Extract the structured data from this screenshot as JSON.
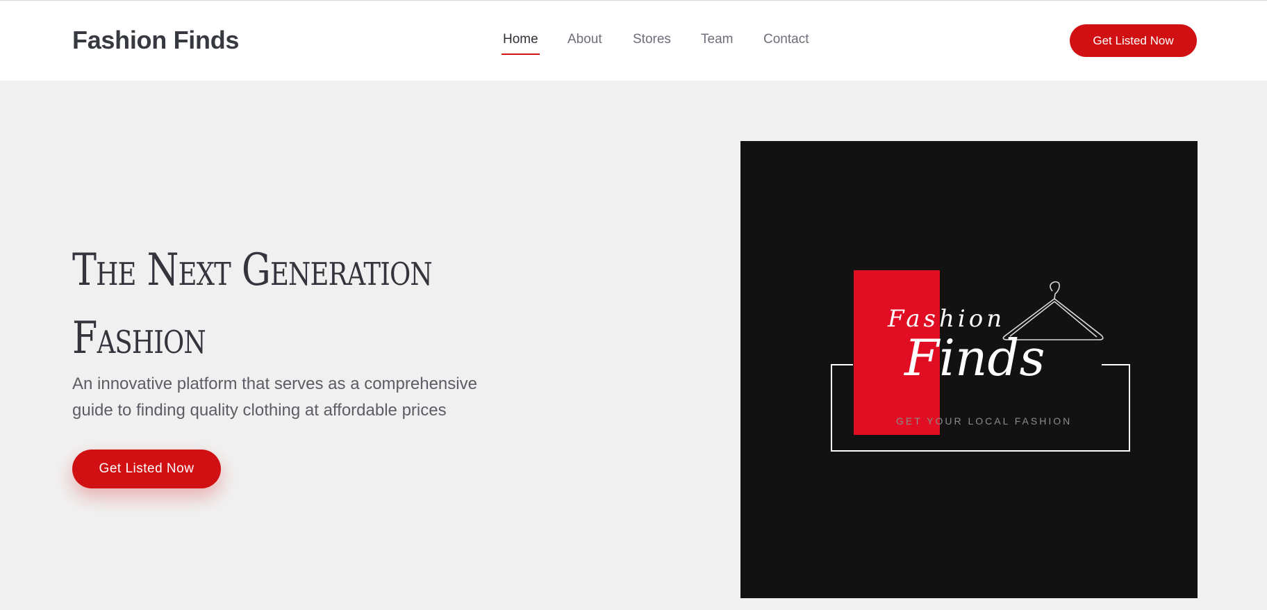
{
  "header": {
    "brand": "Fashion Finds",
    "nav": [
      {
        "label": "Home",
        "active": true
      },
      {
        "label": "About",
        "active": false
      },
      {
        "label": "Stores",
        "active": false
      },
      {
        "label": "Team",
        "active": false
      },
      {
        "label": "Contact",
        "active": false
      }
    ],
    "cta_label": "Get Listed Now"
  },
  "hero": {
    "title_lines": [
      "The Next Generation",
      "Fashion"
    ],
    "description": "An innovative platform that serves as a comprehensive guide to finding quality clothing at affordable prices",
    "cta_label": "Get Listed Now"
  },
  "logo": {
    "script_small": "Fashion",
    "script_big": "Finds",
    "tagline": "GET YOUR LOCAL FASHION",
    "icon": "hanger-icon"
  },
  "colors": {
    "accent": "#d01012",
    "logo_red": "#e10d22",
    "logo_background": "#121212",
    "page_background": "#f1f0f0",
    "header_background": "#ffffff",
    "text_dark": "#33343c"
  }
}
